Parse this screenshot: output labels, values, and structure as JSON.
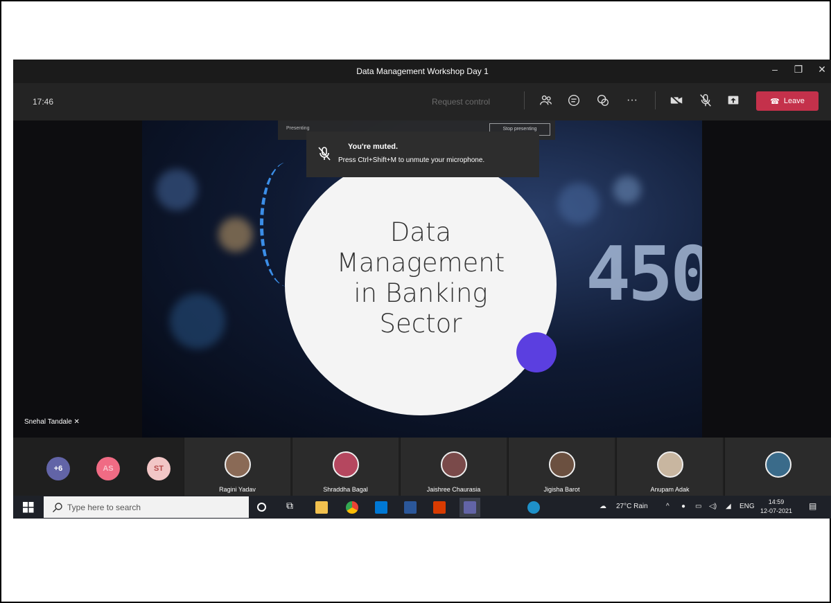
{
  "window": {
    "title": "Data Management Workshop Day 1"
  },
  "toolbar": {
    "timer": "17:46",
    "request_control": "Request control",
    "leave_label": "Leave"
  },
  "presenting": {
    "label": "Presenting",
    "stop_label": "Stop presenting"
  },
  "toast": {
    "title": "You're muted.",
    "message": "Press Ctrl+Shift+M to unmute your microphone."
  },
  "slide": {
    "line1": "Data",
    "line2": "Management",
    "line3": "in Banking",
    "line4": "Sector",
    "background_digits": "450"
  },
  "speaker": {
    "name": "Snehal Tandale"
  },
  "participants": {
    "overflow": "+6",
    "bubbles": [
      {
        "initials": "AS",
        "color": "#f06b84"
      },
      {
        "initials": "ST",
        "color": "#f2c6c6"
      }
    ],
    "tiles": [
      {
        "name": "Ragini Yadav"
      },
      {
        "name": "Shraddha Bagal"
      },
      {
        "name": "Jaishree Chaurasia"
      },
      {
        "name": "Jigisha Barot"
      },
      {
        "name": "Anupam Adak"
      },
      {
        "name": ""
      }
    ]
  },
  "taskbar": {
    "search_placeholder": "Type here to search",
    "weather": "27°C Rain",
    "language": "ENG",
    "time": "14:59",
    "date": "12-07-2021"
  },
  "colors": {
    "leave": "#c4314b",
    "accent_purple": "#5b3fe0",
    "overflow_bubble": "#6264a7"
  }
}
